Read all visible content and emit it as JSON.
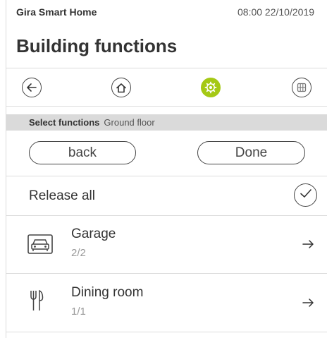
{
  "status_bar": {
    "app_name": "Gira Smart Home",
    "clock": "08:00 22/10/2019"
  },
  "page": {
    "title": "Building functions"
  },
  "nav": {
    "items": [
      {
        "icon": "back-arrow-icon"
      },
      {
        "icon": "home-icon"
      },
      {
        "icon": "settings-gear-icon",
        "active": true
      },
      {
        "icon": "grid-icon"
      }
    ],
    "active_color": "#a5c915"
  },
  "selection": {
    "label": "Select functions",
    "value": "Ground floor"
  },
  "actions": {
    "back_label": "back",
    "done_label": "Done"
  },
  "release": {
    "label": "Release all",
    "icon": "checkmark-icon"
  },
  "rooms": [
    {
      "name": "Garage",
      "count": "2/2",
      "icon": "garage-car-icon"
    },
    {
      "name": "Dining room",
      "count": "1/1",
      "icon": "fork-knife-icon"
    }
  ]
}
